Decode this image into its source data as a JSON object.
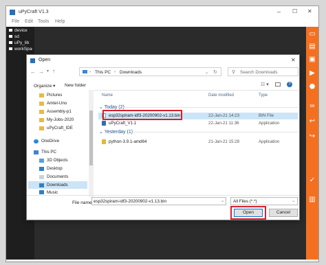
{
  "window": {
    "title": "uPyCraft V1.3",
    "controls": {
      "minimize": "–",
      "maximize": "☐",
      "close": "✕"
    }
  },
  "menu": [
    "File",
    "Edit",
    "Tools",
    "Help"
  ],
  "tree": [
    "device",
    "sd",
    "uPy_lib",
    "workSpace"
  ],
  "toolbar_icons": [
    "new-file",
    "open-folder",
    "save",
    "download-and-run",
    "stop",
    "connect",
    "undo",
    "redo",
    "syntax-check",
    "clear"
  ],
  "dialog": {
    "title": "Open",
    "close": "✕",
    "address": [
      "This PC",
      "Downloads"
    ],
    "search_placeholder": "Search Downloads",
    "organize": "Organize ▾",
    "new_folder": "New folder",
    "nav_items": [
      "Pictures",
      "Amtel-Uno",
      "Assembly-p1",
      "My-Jobs-2020",
      "uPyCraft_IDE",
      "OneDrive",
      "This PC",
      "3D Objects",
      "Desktop",
      "Documents",
      "Downloads",
      "Music"
    ],
    "nav_selected": "Downloads",
    "columns": {
      "name": "Name",
      "date": "Date modified",
      "type": "Type"
    },
    "groups": [
      {
        "label": "Today (2)",
        "files": [
          {
            "name": "esp32spiram-idf3-20200902-v1.13.bin",
            "date": "22-Jan-21 14:23",
            "type": "BIN File",
            "selected": true
          },
          {
            "name": "uPyCraft_V1.1",
            "date": "22-Jan-21 11:36",
            "type": "Application"
          }
        ]
      },
      {
        "label": "Yesterday (1)",
        "files": [
          {
            "name": "python-3.9.1-amd64",
            "date": "21-Jan-21 15:28",
            "type": "Application"
          }
        ]
      }
    ],
    "file_name_label": "File name:",
    "file_name_value": "esp32spiram-idf3-20200902-v1.13.bin",
    "file_type": "All Files (*.*)",
    "open_button": "Open",
    "cancel_button": "Cancel"
  },
  "colors": {
    "accent_bar": "#f37021",
    "highlight": "#d81e2a",
    "selection": "#cce4f7"
  }
}
